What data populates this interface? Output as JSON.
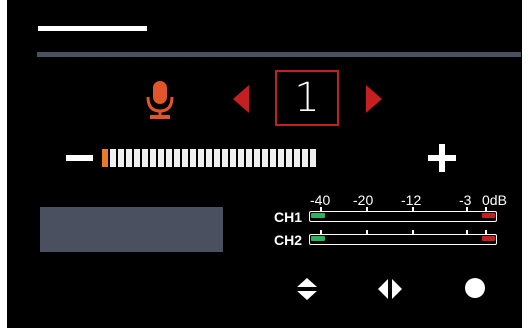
{
  "colors": {
    "background": "#000000",
    "accent_orange": "#e2552a",
    "accent_red": "#c42020",
    "meter_green": "#2db35c",
    "panel_gray": "#4a5060"
  },
  "channel": {
    "number": "1"
  },
  "level": {
    "segments_total": 27,
    "segments_active": 1
  },
  "meter_scale": {
    "labels": [
      "-40",
      "-20",
      "-12",
      "-3",
      "0dB"
    ]
  },
  "channels": [
    {
      "label": "CH1"
    },
    {
      "label": "CH2"
    }
  ],
  "icons": {
    "mic": "microphone-icon",
    "prev": "triangle-left-icon",
    "next": "triangle-right-icon",
    "minus": "minus-icon",
    "plus": "plus-icon",
    "up_down": "up-down-arrows-icon",
    "left_right": "left-right-arrows-icon",
    "record": "record-circle-icon"
  }
}
